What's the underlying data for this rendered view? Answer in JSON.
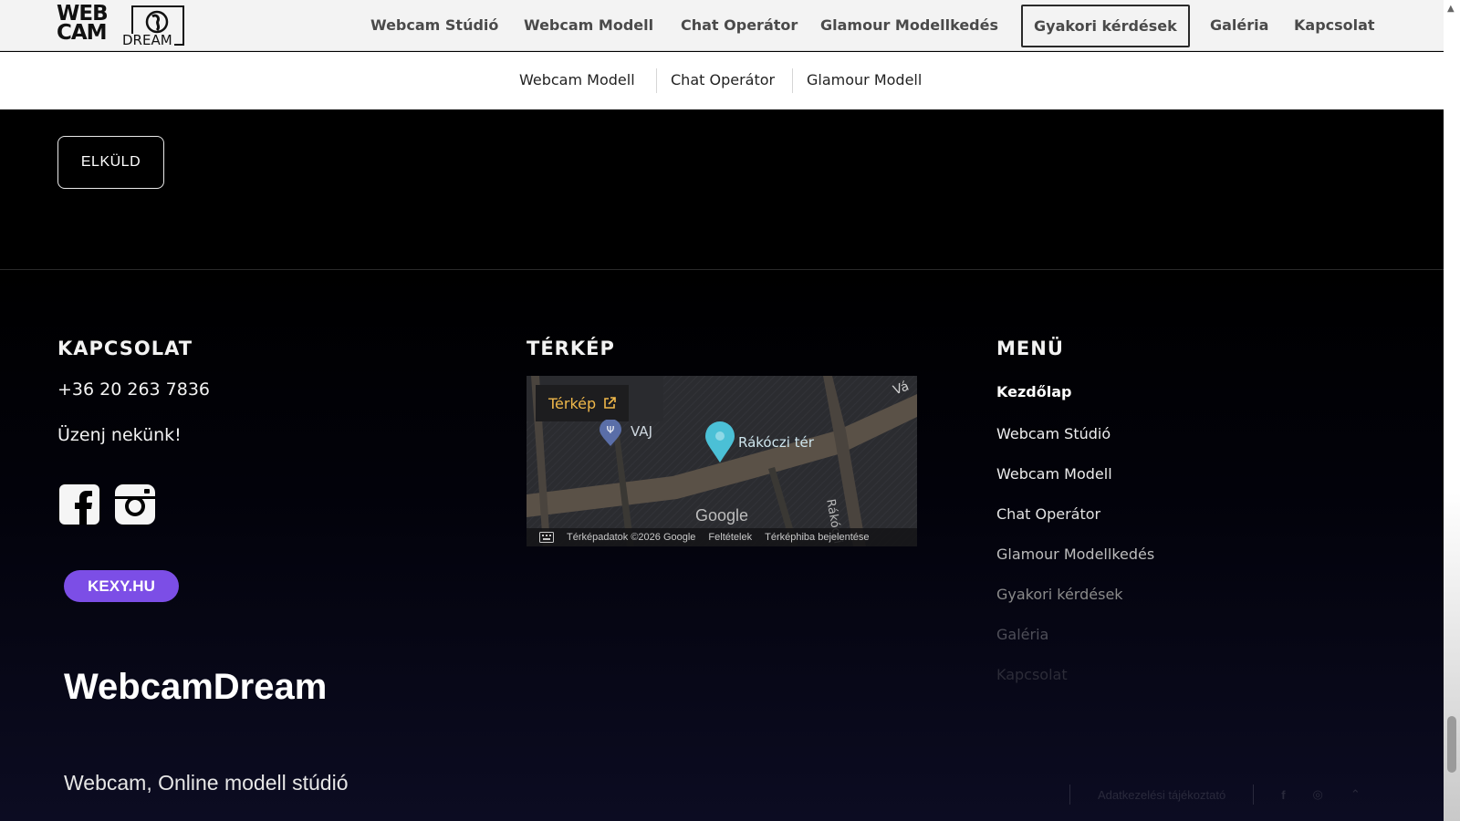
{
  "logo": {
    "line1": "WEB",
    "line2": "CAM",
    "line3": "DREAM"
  },
  "nav": {
    "items": [
      {
        "label": "Webcam Stúdió"
      },
      {
        "label": "Webcam Modell"
      },
      {
        "label": "Chat Operátor"
      },
      {
        "label": "Glamour Modellkedés"
      },
      {
        "label": "Gyakori kérdések",
        "active": true
      },
      {
        "label": "Galéria"
      },
      {
        "label": "Kapcsolat"
      }
    ]
  },
  "subnav": {
    "items": [
      {
        "label": "Webcam Modell"
      },
      {
        "label": "Chat Operátor"
      },
      {
        "label": "Glamour Modell"
      }
    ]
  },
  "form": {
    "submit_label": "ELKÜLD"
  },
  "footer": {
    "contact": {
      "title": "KAPCSOLAT",
      "phone": "+36 20 263 7836",
      "message_link": "Üzenj nekünk!",
      "social": [
        {
          "icon": "facebook-icon"
        },
        {
          "icon": "instagram-icon"
        }
      ],
      "badge": "KEXY.HU",
      "brand": "WebcamDream",
      "tagline": "Webcam, Online modell stúdió"
    },
    "map": {
      "title": "TÉRKÉP",
      "button_label": "Térkép",
      "labels": {
        "place": "Rákóczi tér",
        "poi": "VAJ",
        "street": "Rákóczi tér",
        "corner": "Vá"
      },
      "google": "Google",
      "attribution": "Térképadatok ©2026 Google",
      "terms": "Feltételek",
      "report": "Térképhiba bejelentése"
    },
    "menu": {
      "title": "MENÜ",
      "items": [
        {
          "label": "Kezdőlap",
          "color": "#ffffff"
        },
        {
          "label": "Webcam Stúdió",
          "color": "#f0f0f0"
        },
        {
          "label": "Webcam Modell",
          "color": "#ececec"
        },
        {
          "label": "Chat Operátor",
          "color": "#e2e2e2"
        },
        {
          "label": "Glamour Modellkedés",
          "color": "#bdbdbd"
        },
        {
          "label": "Gyakori kérdések",
          "color": "#8a8a8a"
        },
        {
          "label": "Galéria",
          "color": "#4e4e58"
        },
        {
          "label": "Kapcsolat",
          "color": "#2c2c38"
        }
      ]
    },
    "bottom": {
      "privacy": "Adatkezelési tájékoztató"
    }
  },
  "colors": {
    "accent": "#7c4ee6",
    "map_link": "#f0b84a",
    "background": "#000000"
  }
}
